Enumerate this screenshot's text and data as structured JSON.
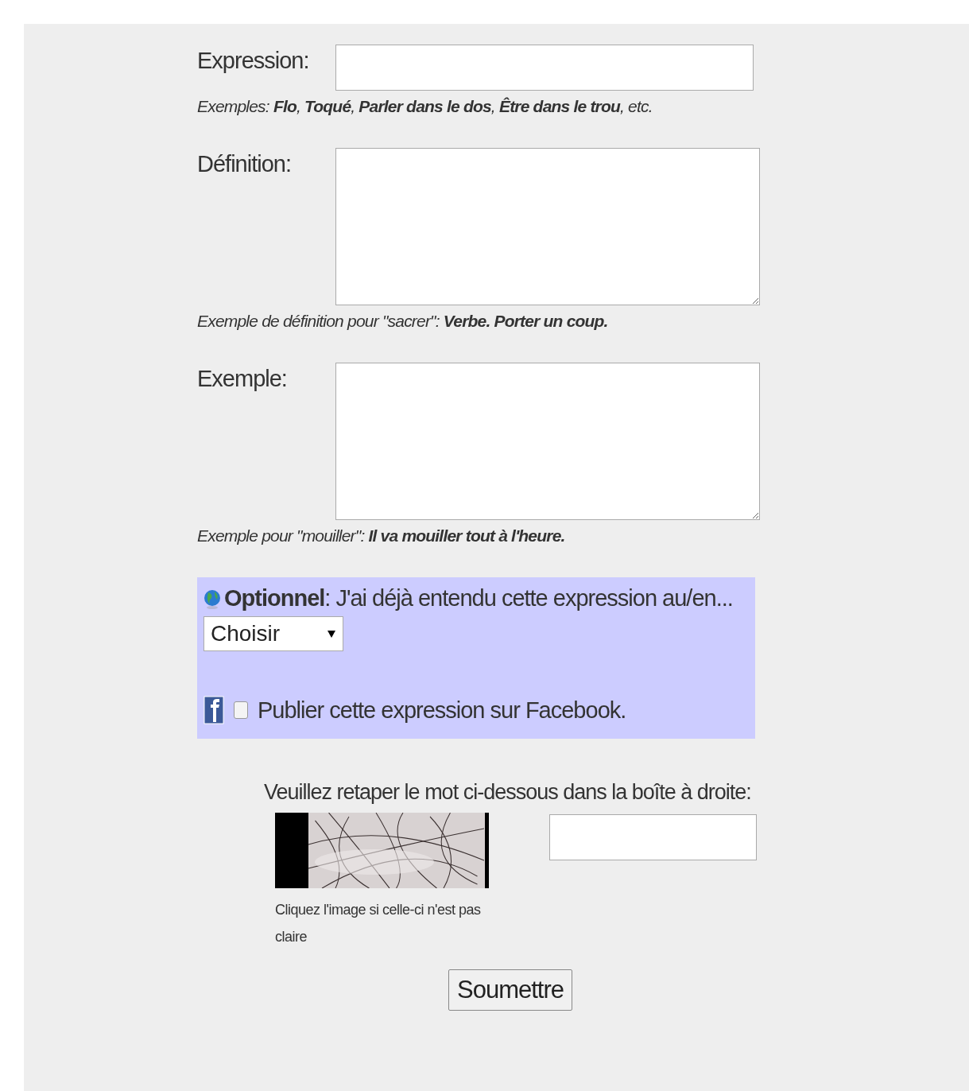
{
  "fields": [
    {
      "kind": "input",
      "label": "Expression:",
      "hint": "Exemples: **Flo**, **Toqué**, **Parler dans le dos**, **Être dans le trou**, etc."
    },
    {
      "kind": "textarea",
      "label": "Définition:",
      "hint": "Exemple de définition pour \"sacrer\": **Verbe. Porter un coup.**"
    },
    {
      "kind": "textarea",
      "label": "Exemple:",
      "hint": "Exemple pour \"mouiller\": **Il va mouiller tout à l'heure.**"
    }
  ],
  "optional": {
    "text": "**Optionnel**: J'ai déjà entendu cette expression au/en...",
    "select": "Choisir",
    "facebook": {
      "checked": false,
      "label": "Publier cette expression sur Facebook."
    }
  },
  "captcha": {
    "prompt": "Veuillez retaper le mot ci-dessous dans la boîte à droite:",
    "caption": "Cliquez l'image si celle-ci n'est pas claire"
  },
  "submit": "Soumettre"
}
